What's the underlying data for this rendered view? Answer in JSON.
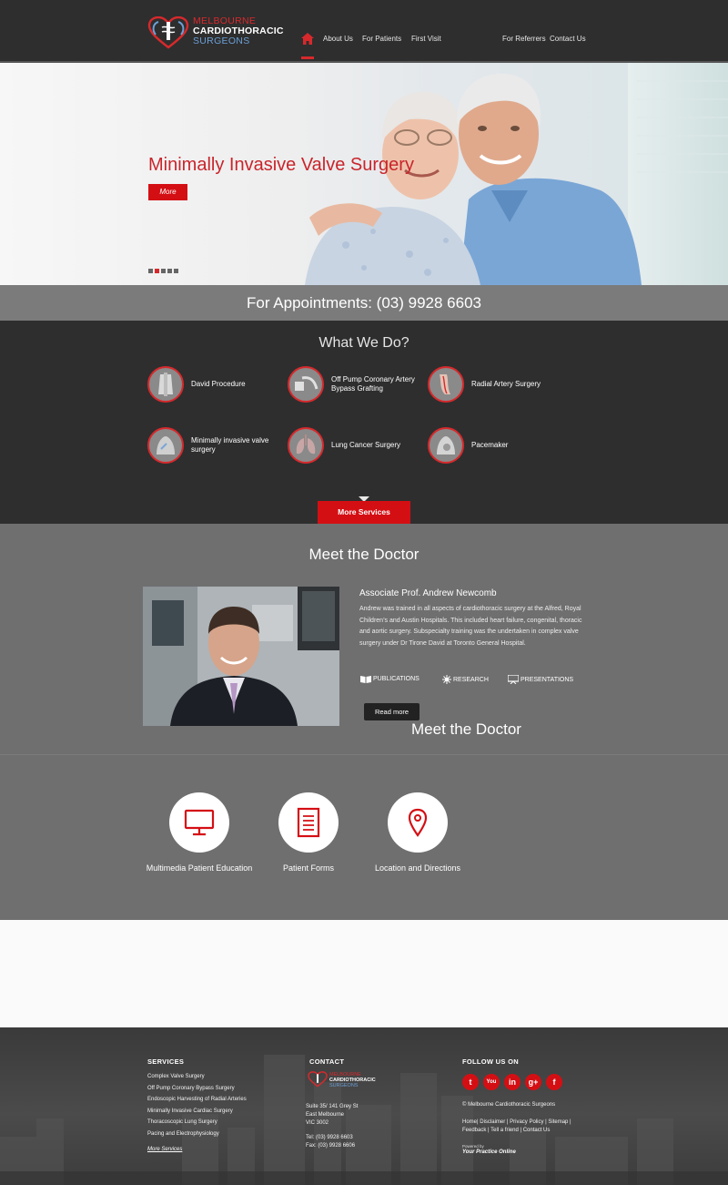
{
  "brand": {
    "line1": "MELBOURNE",
    "line2": "CARDIOTHORACIC",
    "line3": "SURGEONS",
    "colors": {
      "red": "#d7292c",
      "blue": "#6c9fd6",
      "dark": "#2e2e2e",
      "grey": "#6f6f6f"
    }
  },
  "nav": {
    "home_icon": "home-icon",
    "items": [
      "About Us",
      "For Patients",
      "First Visit",
      "For Referrers",
      "Contact Us"
    ]
  },
  "hero": {
    "title": "Minimally Invasive Valve Surgery",
    "button": "More",
    "slide_count": 5,
    "active_slide": 2
  },
  "appointment": {
    "text": "For Appointments: (03) 9928 6603"
  },
  "what_we_do": {
    "title": "What We Do?",
    "services": [
      {
        "label": "David Procedure",
        "icon": "heart-valve-icon"
      },
      {
        "label": "Off Pump Coronary Artery Bypass Grafting",
        "icon": "bypass-icon"
      },
      {
        "label": "Radial Artery Surgery",
        "icon": "arm-artery-icon"
      },
      {
        "label": "Minimally invasive valve surgery",
        "icon": "chest-incision-icon"
      },
      {
        "label": "Lung Cancer Surgery",
        "icon": "lungs-icon"
      },
      {
        "label": "Pacemaker",
        "icon": "pacemaker-icon"
      }
    ],
    "more_button": "More Services"
  },
  "doctor": {
    "title": "Meet the Doctor",
    "name": "Associate Prof. Andrew Newcomb",
    "bio": "Andrew was trained in all aspects of cardiothoracic surgery at the Alfred, Royal Children’s and Austin Hospitals. This included heart failure, congenital, thoracic and aortic surgery. Subspecialty training was the undertaken in complex valve surgery under Dr Tirone David at Toronto General Hospital.",
    "links": [
      "PUBLICATIONS",
      "RESEARCH",
      "PRESENTATIONS"
    ],
    "read_more": "Read more",
    "title_repeat": "Meet the Doctor"
  },
  "features": [
    {
      "label": "Multimedia Patient Education",
      "icon": "monitor-icon"
    },
    {
      "label": "Patient Forms",
      "icon": "document-icon"
    },
    {
      "label": "Location and Directions",
      "icon": "map-pin-icon"
    }
  ],
  "footer": {
    "services_heading": "SERVICES",
    "services": [
      "Complex Valve Surgery",
      "Off Pump Coronary Bypass Surgery",
      "Endoscopic Harvesting of Radial Arteries",
      "Minimally Invasive Cardiac Surgery",
      "Thoracoscopic Lung Surgery",
      "Pacing and Electrophysiology"
    ],
    "more_services": "More Services",
    "contact_heading": "CONTACT",
    "address": [
      "Suite 35/ 141 Grey St",
      "East Melbourne",
      "VIC 3002"
    ],
    "phone": "Tel: (03) 9928 6603",
    "fax": "Fax: (03) 9928 6606",
    "follow_heading": "FOLLOW US ON",
    "social": [
      "t",
      "You",
      "in",
      "g+",
      "f"
    ],
    "copyright": "© Melbourne Cardiothoracic Surgeons",
    "links": "Home| Disclaimer | Privacy Policy | Sitemap | Feedback | Tell a friend | Contact Us",
    "powered_by": "Powered by",
    "powered_name": "Your Practice Online"
  }
}
